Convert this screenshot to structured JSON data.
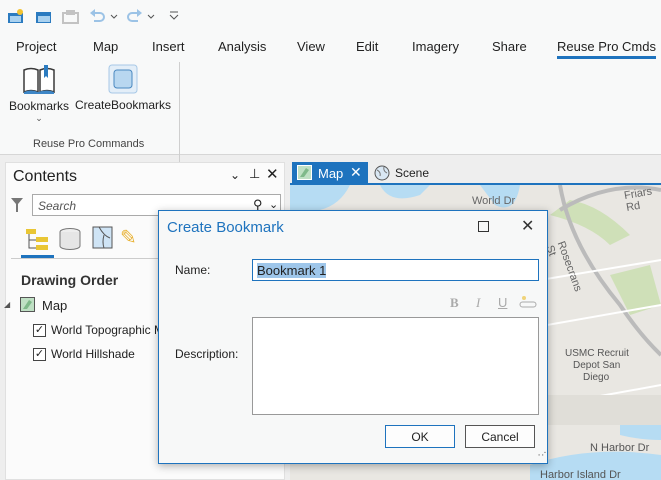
{
  "quick_access": {
    "icons": [
      "new-project-icon",
      "open-project-icon",
      "save-icon",
      "undo-icon",
      "redo-icon",
      "customize-icon"
    ]
  },
  "ribbon": {
    "tabs": [
      {
        "label": "Project"
      },
      {
        "label": "Map"
      },
      {
        "label": "Insert"
      },
      {
        "label": "Analysis"
      },
      {
        "label": "View"
      },
      {
        "label": "Edit"
      },
      {
        "label": "Imagery"
      },
      {
        "label": "Share"
      },
      {
        "label": "Reuse Pro Cmds",
        "active": true
      }
    ],
    "buttons": [
      {
        "label": "Bookmarks"
      },
      {
        "label": "CreateBookmarks"
      }
    ],
    "group_label": "Reuse Pro Commands"
  },
  "contents": {
    "title": "Contents",
    "search_placeholder": "Search",
    "section": "Drawing Order",
    "map_label": "Map",
    "layers": [
      {
        "label": "World Topographic Map",
        "checked": true
      },
      {
        "label": "World Hillshade",
        "checked": true
      }
    ]
  },
  "view_tabs": [
    {
      "label": "Map",
      "active": true
    },
    {
      "label": "Scene"
    }
  ],
  "map_labels": [
    "Friars Rd",
    "World Dr",
    "Rosecrans St",
    "USMC Recruit",
    "Depot San",
    "Diego",
    "N Harbor Dr",
    "Harbor Island Dr"
  ],
  "dialog": {
    "title": "Create Bookmark",
    "name_label": "Name:",
    "name_value": "Bookmark 1",
    "format": [
      "B",
      "I",
      "U"
    ],
    "description_label": "Description:",
    "description_value": "",
    "ok": "OK",
    "cancel": "Cancel"
  },
  "colors": {
    "accent": "#1e73be",
    "selection": "#9ec6ea"
  }
}
